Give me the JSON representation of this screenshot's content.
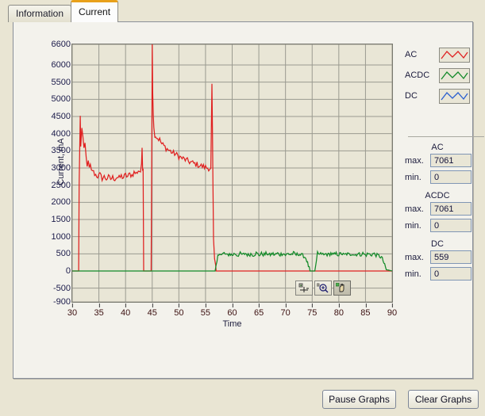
{
  "tabs": [
    {
      "label": "Information",
      "active": false
    },
    {
      "label": "Current",
      "active": true
    }
  ],
  "legend": [
    {
      "label": "AC",
      "color": "#e02020",
      "icon": "line-sample-icon"
    },
    {
      "label": "ACDC",
      "color": "#128a28",
      "icon": "line-sample-icon"
    },
    {
      "label": "DC",
      "color": "#2a5fd0",
      "icon": "line-sample-icon"
    }
  ],
  "stats": [
    {
      "title": "AC",
      "max_label": "max.",
      "max_value": "7061",
      "min_label": "min.",
      "min_value": "0"
    },
    {
      "title": "ACDC",
      "max_label": "max.",
      "max_value": "7061",
      "min_label": "min.",
      "min_value": "0"
    },
    {
      "title": "DC",
      "max_label": "max.",
      "max_value": "559",
      "min_label": "min.",
      "min_value": "0"
    }
  ],
  "chart_tools": [
    {
      "name": "crosshair-tool",
      "pressed": false
    },
    {
      "name": "zoom-tool",
      "pressed": false
    },
    {
      "name": "pan-hand-tool",
      "pressed": true
    }
  ],
  "buttons": {
    "pause": "Pause Graphs",
    "clear": "Clear Graphs"
  },
  "chart_data": {
    "type": "line",
    "title": "",
    "xlabel": "Time",
    "ylabel": "Current, mA",
    "xlim": [
      30,
      90
    ],
    "ylim": [
      -900,
      6600
    ],
    "xticks": [
      30,
      35,
      40,
      45,
      50,
      55,
      60,
      65,
      70,
      75,
      80,
      85,
      90
    ],
    "yticks": [
      -900,
      -500,
      0,
      500,
      1000,
      1500,
      2000,
      2500,
      3000,
      3500,
      4000,
      4500,
      5000,
      5500,
      6000,
      6600
    ],
    "grid": true,
    "legend_position": "right",
    "plot_bgcolor": "#e9e6d6",
    "grid_color": "#9a9a90",
    "series": [
      {
        "name": "AC",
        "color": "#e02020",
        "x": [
          30.0,
          31.2,
          31.3,
          31.5,
          31.6,
          31.8,
          32.0,
          32.2,
          32.4,
          32.6,
          32.8,
          33.0,
          33.2,
          33.4,
          33.6,
          33.8,
          34.0,
          34.4,
          34.8,
          35.2,
          35.6,
          36.0,
          36.4,
          36.8,
          37.2,
          37.6,
          38.0,
          38.4,
          38.8,
          39.2,
          39.6,
          40.0,
          40.4,
          40.8,
          41.2,
          41.6,
          42.0,
          42.4,
          42.8,
          43.0,
          43.1,
          43.2,
          43.3,
          43.4,
          43.6,
          44.0,
          44.4,
          44.8,
          44.9,
          45.0,
          45.1,
          45.2,
          45.3,
          45.5,
          45.8,
          46.0,
          46.4,
          46.8,
          47.2,
          47.6,
          48.0,
          48.4,
          48.8,
          49.2,
          49.6,
          50.0,
          50.4,
          50.8,
          51.2,
          51.6,
          52.0,
          52.4,
          52.8,
          53.2,
          53.6,
          54.0,
          54.4,
          54.8,
          55.2,
          55.6,
          56.0,
          56.2,
          56.3,
          56.4,
          56.5,
          56.7,
          56.9,
          57.0,
          57.1,
          90.0
        ],
        "y": [
          0,
          0,
          2500,
          4520,
          3600,
          4200,
          3900,
          3500,
          3700,
          3300,
          3100,
          3150,
          2980,
          3050,
          2900,
          2950,
          2870,
          2800,
          2760,
          2800,
          2700,
          2740,
          2690,
          2730,
          2680,
          2720,
          2690,
          2740,
          2700,
          2760,
          2720,
          2790,
          2750,
          2820,
          2790,
          2870,
          2840,
          2930,
          2900,
          3050,
          3600,
          3000,
          2980,
          0,
          0,
          0,
          0,
          0,
          3000,
          6600,
          5200,
          4600,
          4150,
          3980,
          3900,
          3870,
          3820,
          3700,
          3640,
          3580,
          3530,
          3490,
          3440,
          3420,
          3380,
          3340,
          3300,
          3270,
          3240,
          3210,
          3180,
          3160,
          3130,
          3110,
          3090,
          3070,
          3050,
          3030,
          3010,
          3000,
          2990,
          5450,
          4200,
          2500,
          900,
          300,
          120,
          0,
          0,
          0
        ]
      },
      {
        "name": "DC",
        "color": "#128a28",
        "x": [
          30.0,
          56.8,
          57.0,
          57.3,
          57.6,
          58.0,
          58.5,
          59.0,
          59.5,
          60.0,
          60.5,
          61.0,
          61.5,
          62.0,
          62.5,
          63.0,
          63.5,
          64.0,
          64.5,
          65.0,
          65.5,
          66.0,
          66.5,
          67.0,
          67.5,
          68.0,
          68.5,
          69.0,
          69.5,
          70.0,
          70.5,
          71.0,
          71.5,
          72.0,
          72.5,
          73.0,
          73.4,
          73.8,
          74.0,
          74.3,
          74.6,
          75.5,
          75.8,
          76.0,
          76.4,
          76.8,
          77.2,
          77.6,
          78.0,
          78.5,
          79.0,
          79.5,
          80.0,
          80.5,
          81.0,
          81.5,
          82.0,
          82.5,
          83.0,
          83.5,
          84.0,
          84.5,
          85.0,
          85.5,
          86.0,
          86.5,
          87.0,
          87.5,
          88.0,
          88.3,
          88.6,
          88.9,
          90.0
        ],
        "y": [
          0,
          0,
          120,
          420,
          540,
          470,
          520,
          450,
          500,
          460,
          510,
          455,
          505,
          470,
          515,
          460,
          500,
          470,
          520,
          465,
          500,
          475,
          515,
          460,
          505,
          470,
          510,
          475,
          520,
          465,
          505,
          480,
          515,
          470,
          500,
          460,
          440,
          380,
          300,
          150,
          0,
          0,
          240,
          530,
          470,
          510,
          460,
          500,
          470,
          515,
          465,
          505,
          475,
          510,
          460,
          500,
          470,
          515,
          465,
          505,
          475,
          510,
          460,
          500,
          470,
          505,
          465,
          440,
          400,
          300,
          160,
          40,
          0
        ]
      }
    ]
  }
}
